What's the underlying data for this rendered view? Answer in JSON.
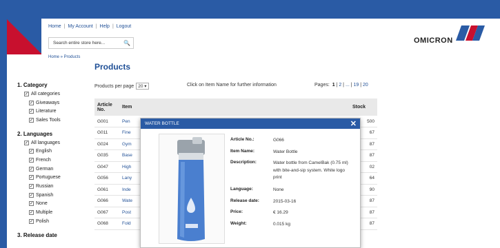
{
  "header": {
    "links": [
      "Home",
      "My Account",
      "Help",
      "Logout"
    ],
    "search_placeholder": "Search entire store here...",
    "breadcrumb": "Home » Products",
    "logo_text": "OMICRON"
  },
  "sidebar": {
    "category": {
      "title": "1. Category",
      "all": "All categories",
      "items": [
        "Giveaways",
        "Literature",
        "Sales Tools"
      ]
    },
    "languages": {
      "title": "2. Languages",
      "all": "All languages",
      "items": [
        "English",
        "French",
        "German",
        "Portuguese",
        "Russian",
        "Spanish",
        "None",
        "Multiple",
        "Polish"
      ]
    },
    "release": {
      "title": "3. Release date"
    }
  },
  "main": {
    "title": "Products",
    "per_page_label": "Products per page",
    "per_page_value": "20",
    "hint": "Click on Item Name for further information",
    "pages_label": "Pages:",
    "pages": [
      "1",
      "2",
      "...",
      "19",
      "20"
    ],
    "columns": [
      "Article No.",
      "Item",
      "Stock"
    ],
    "rows": [
      {
        "article": "G001",
        "item": "Pen",
        "stock": "500"
      },
      {
        "article": "G011",
        "item": "Fine",
        "stock": "67"
      },
      {
        "article": "G024",
        "item": "Gym",
        "stock": "87"
      },
      {
        "article": "G035",
        "item": "Base",
        "stock": "87"
      },
      {
        "article": "G047",
        "item": "High",
        "stock": "02"
      },
      {
        "article": "G056",
        "item": "Lany",
        "stock": "64"
      },
      {
        "article": "G061",
        "item": "Inde",
        "stock": "90"
      },
      {
        "article": "G066",
        "item": "Wate",
        "stock": "87"
      },
      {
        "article": "G067",
        "item": "Post",
        "stock": "87"
      },
      {
        "article": "G068",
        "item": "Fold",
        "stock": "87"
      }
    ]
  },
  "modal": {
    "title": "WATER BOTTLE",
    "close": "✕",
    "fields": [
      {
        "label": "Article No.:",
        "value": "G066"
      },
      {
        "label": "Item Name:",
        "value": "Water Bottle"
      },
      {
        "label": "Description:",
        "value": "Water bottle from CamelBak (0.75 ml) with bite-and-sip system. White logo print"
      },
      {
        "label": "Language:",
        "value": "None"
      },
      {
        "label": "Release date:",
        "value": "2015-03-16"
      },
      {
        "label": "Price:",
        "value": "€ 16.29"
      },
      {
        "label": "Weight:",
        "value": "0.015 kg"
      }
    ]
  },
  "colors": {
    "brand_blue": "#2a5ba5",
    "brand_red": "#c8102e"
  }
}
